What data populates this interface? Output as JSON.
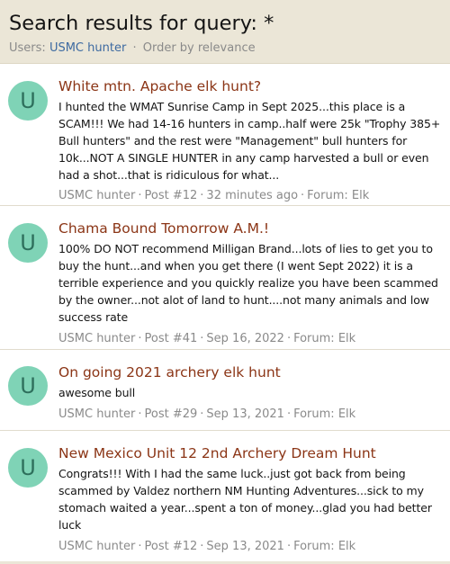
{
  "header": {
    "title": "Search results for query: *",
    "users_label": "Users:",
    "users_value": "USMC hunter",
    "separator": "·",
    "order_label": "Order by relevance"
  },
  "results": [
    {
      "avatar_letter": "U",
      "title": "White mtn. Apache elk hunt?",
      "snippet": "I hunted the WMAT Sunrise Camp in Sept 2025...this place is a SCAM!!! We had 14-16 hunters in camp..half were 25k \"Trophy 385+ Bull hunters\" and the rest were \"Management\" bull hunters for 10k...NOT A SINGLE HUNTER in any camp harvested a bull or even had a shot...that is ridiculous for what...",
      "author": "USMC hunter",
      "post": "Post #12",
      "time": "32 minutes ago",
      "forum": "Forum: Elk"
    },
    {
      "avatar_letter": "U",
      "title": "Chama Bound Tomorrow A.M.!",
      "snippet": "100% DO NOT recommend Milligan Brand...lots of lies to get you to buy the hunt...and when you get there (I went Sept 2022) it is a terrible experience and you quickly realize you have been scammed by the owner...not alot of land to hunt....not many animals and low success rate",
      "author": "USMC hunter",
      "post": "Post #41",
      "time": "Sep 16, 2022",
      "forum": "Forum: Elk"
    },
    {
      "avatar_letter": "U",
      "title": "On going 2021 archery elk hunt",
      "snippet": "awesome bull",
      "author": "USMC hunter",
      "post": "Post #29",
      "time": "Sep 13, 2021",
      "forum": "Forum: Elk"
    },
    {
      "avatar_letter": "U",
      "title": "New Mexico Unit 12 2nd Archery Dream Hunt",
      "snippet": "Congrats!!! With I had the same luck..just got back from being scammed by Valdez northern NM Hunting Adventures...sick to my stomach waited a year...spent a ton of money...glad you had better luck",
      "author": "USMC hunter",
      "post": "Post #12",
      "time": "Sep 13, 2021",
      "forum": "Forum: Elk"
    }
  ],
  "colors": {
    "header_bg": "#ebe6d7",
    "title_link": "#8b3516",
    "user_link": "#3d6aa1",
    "avatar_bg": "#7fd3b6",
    "avatar_text": "#2e6f5c",
    "muted": "#8a8a8a"
  }
}
